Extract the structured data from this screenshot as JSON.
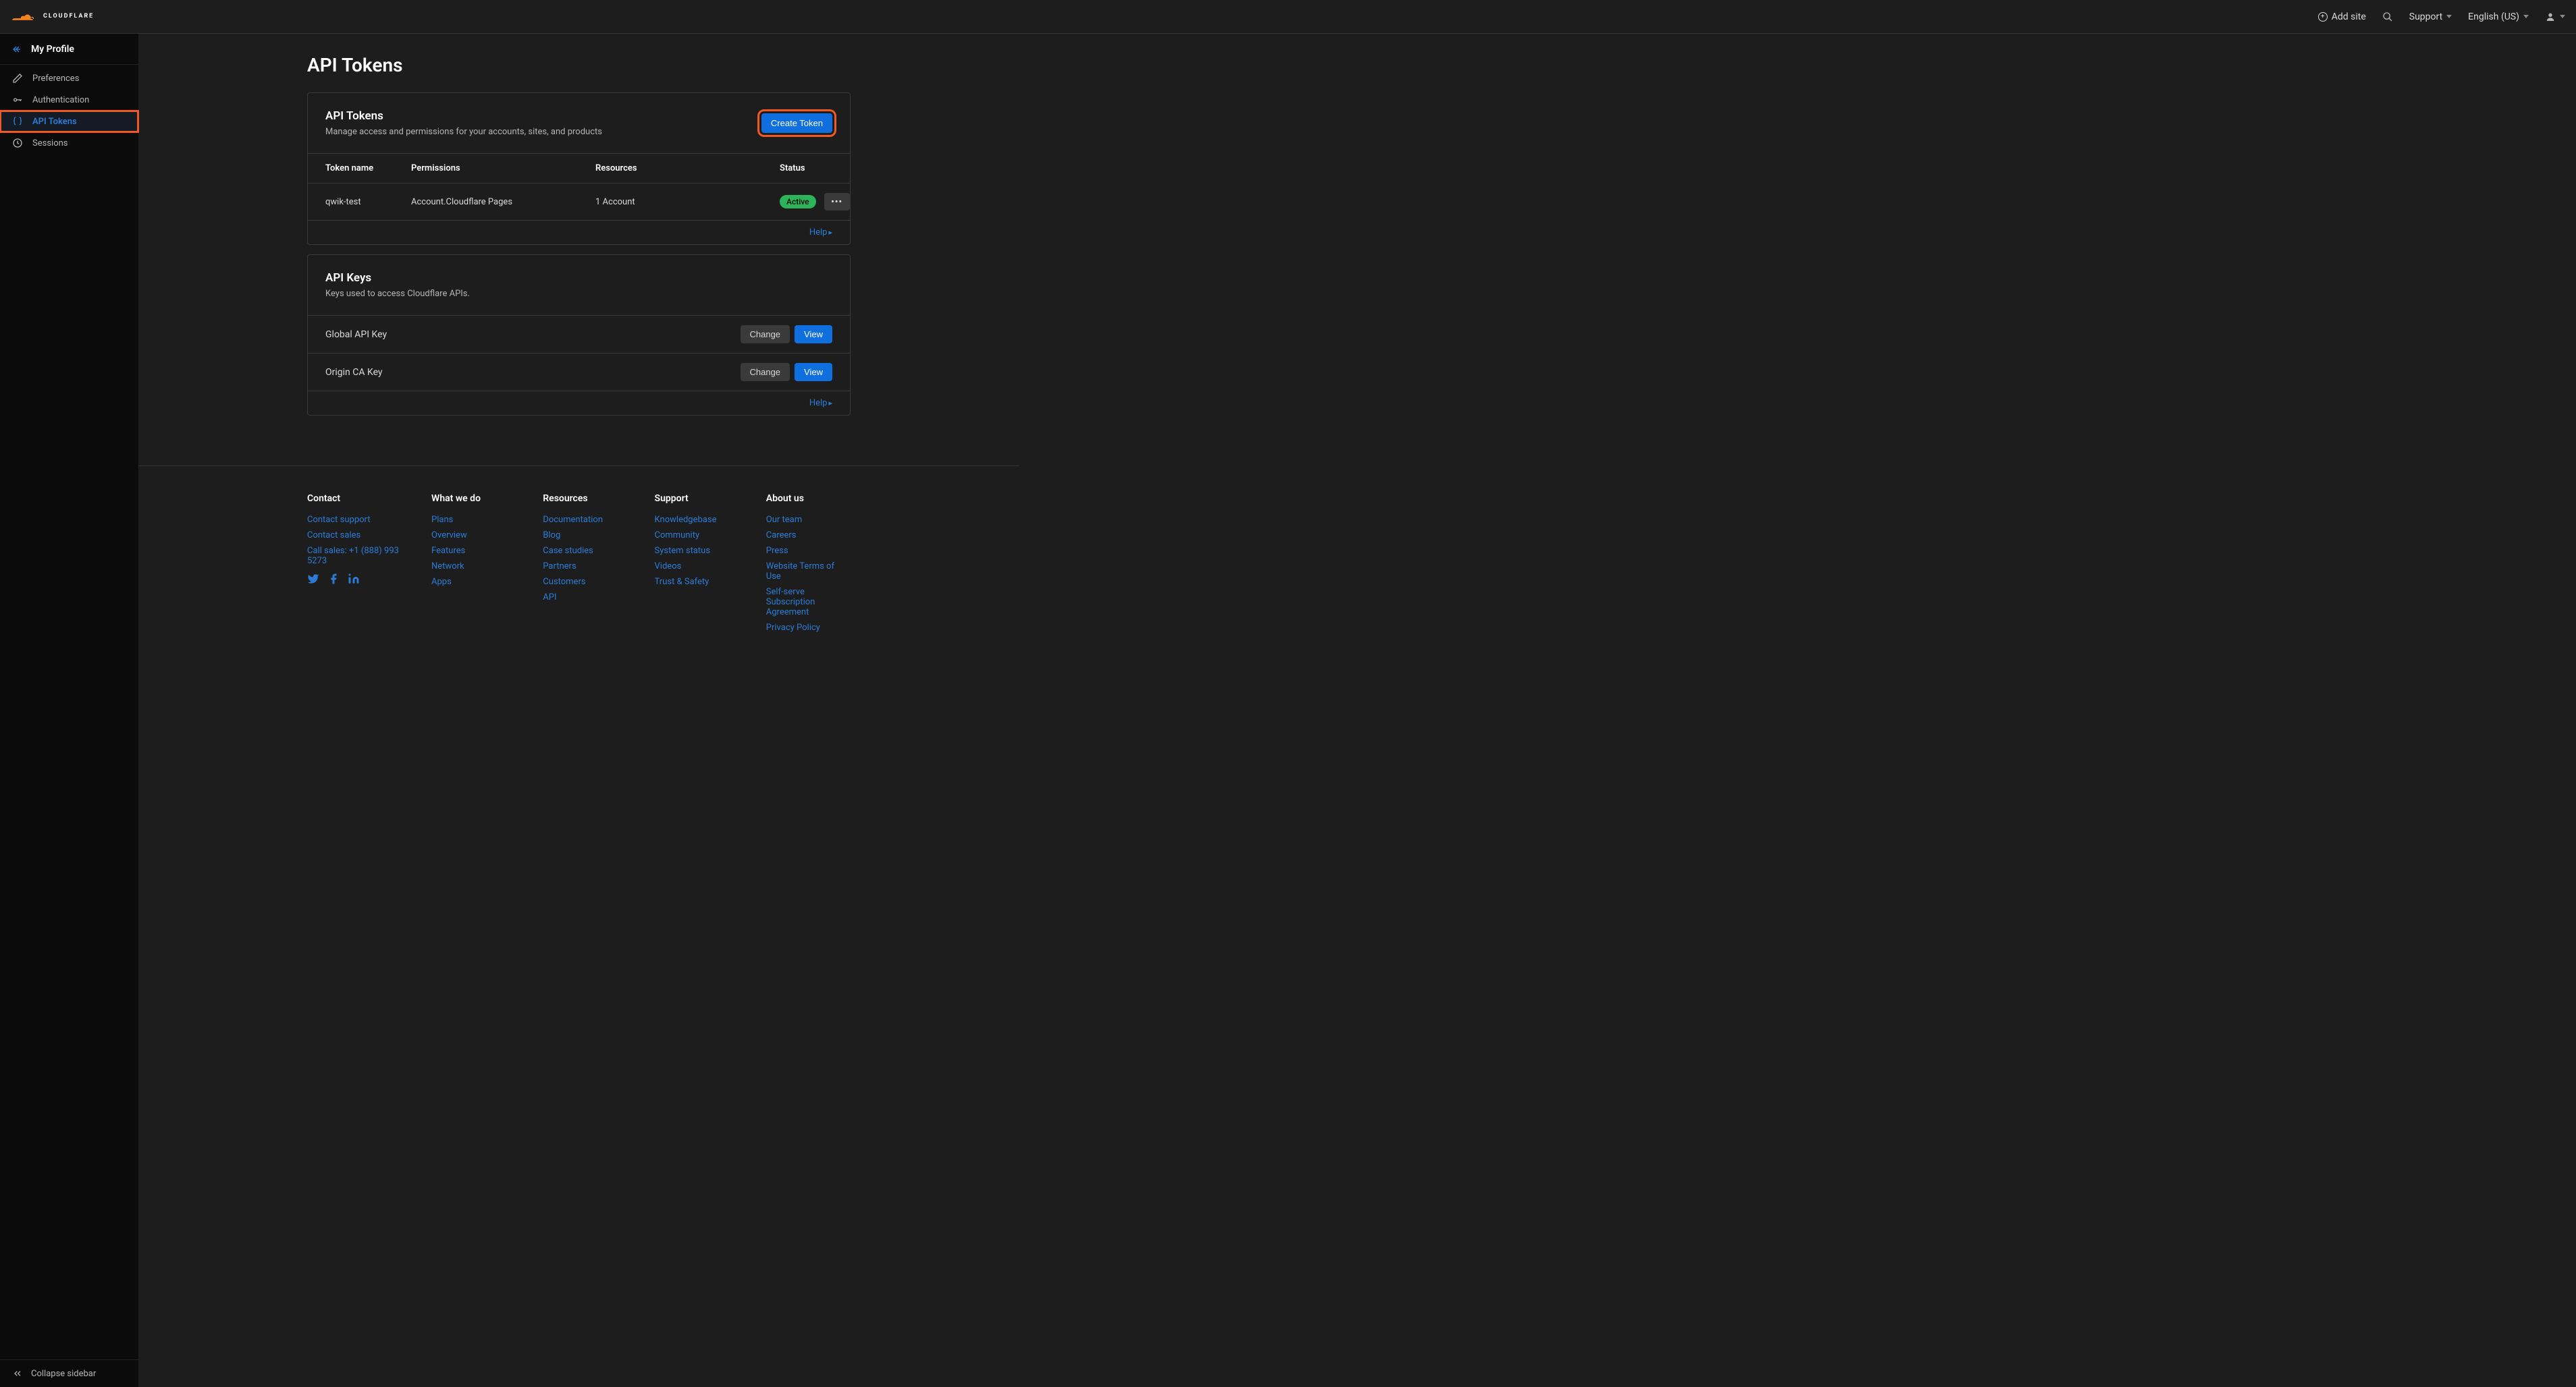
{
  "header": {
    "add_site": "Add site",
    "support": "Support",
    "language": "English (US)"
  },
  "sidebar": {
    "title": "My Profile",
    "items": [
      {
        "label": "Preferences"
      },
      {
        "label": "Authentication"
      },
      {
        "label": "API Tokens"
      },
      {
        "label": "Sessions"
      }
    ],
    "collapse": "Collapse sidebar"
  },
  "page": {
    "title": "API Tokens"
  },
  "tokens_card": {
    "title": "API Tokens",
    "subtitle": "Manage access and permissions for your accounts, sites, and products",
    "create_btn": "Create Token",
    "columns": {
      "name": "Token name",
      "permissions": "Permissions",
      "resources": "Resources",
      "status": "Status"
    },
    "rows": [
      {
        "name": "qwik-test",
        "permissions": "Account.Cloudflare Pages",
        "resources": "1 Account",
        "status": "Active"
      }
    ],
    "help": "Help"
  },
  "keys_card": {
    "title": "API Keys",
    "subtitle": "Keys used to access Cloudflare APIs.",
    "rows": [
      {
        "label": "Global API Key"
      },
      {
        "label": "Origin CA Key"
      }
    ],
    "change_btn": "Change",
    "view_btn": "View",
    "help": "Help"
  },
  "footer": {
    "contact": {
      "title": "Contact",
      "links": [
        "Contact support",
        "Contact sales",
        "Call sales: +1 (888) 993 5273"
      ]
    },
    "what_we_do": {
      "title": "What we do",
      "links": [
        "Plans",
        "Overview",
        "Features",
        "Network",
        "Apps"
      ]
    },
    "resources": {
      "title": "Resources",
      "links": [
        "Documentation",
        "Blog",
        "Case studies",
        "Partners",
        "Customers",
        "API"
      ]
    },
    "support": {
      "title": "Support",
      "links": [
        "Knowledgebase",
        "Community",
        "System status",
        "Videos",
        "Trust & Safety"
      ]
    },
    "about": {
      "title": "About us",
      "links": [
        "Our team",
        "Careers",
        "Press",
        "Website Terms of Use",
        "Self-serve Subscription Agreement",
        "Privacy Policy"
      ]
    }
  }
}
